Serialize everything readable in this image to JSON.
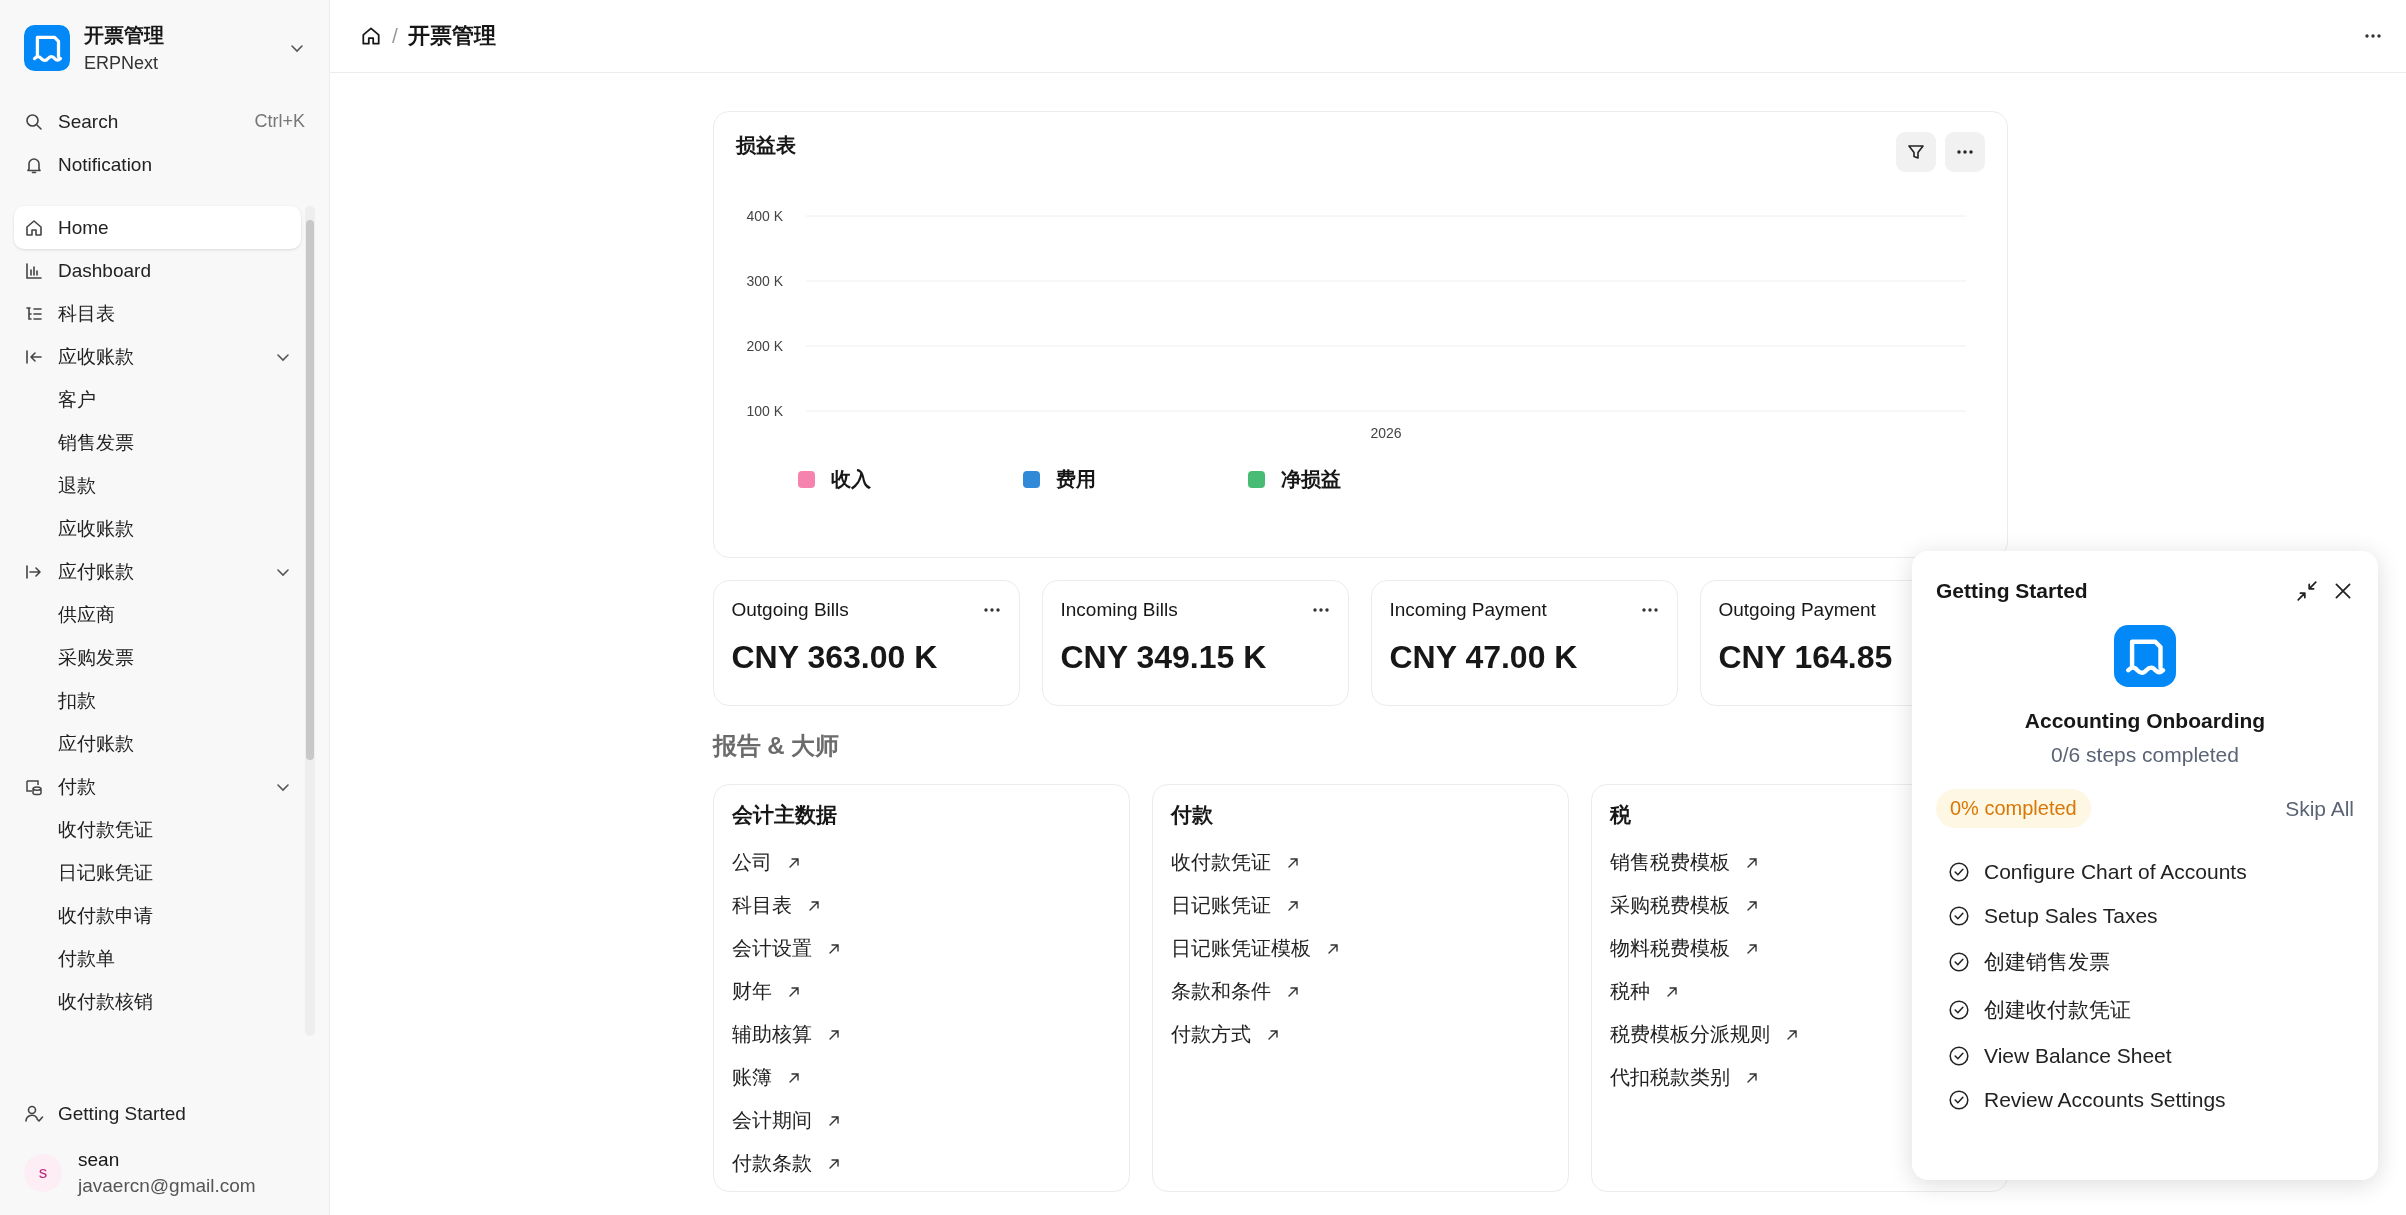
{
  "workspace": {
    "title": "开票管理",
    "subtitle": "ERPNext"
  },
  "quick": [
    {
      "label": "Search",
      "shortcut": "Ctrl+K"
    },
    {
      "label": "Notification"
    }
  ],
  "sidebar": {
    "items": [
      {
        "label": "Home",
        "selected": true
      },
      {
        "label": "Dashboard",
        "selected": false
      },
      {
        "label": "科目表",
        "selected": false
      },
      {
        "label": "应收账款",
        "selected": false,
        "expanded": true,
        "children": [
          {
            "label": "客户",
            "selected": false
          },
          {
            "label": "销售发票",
            "selected": false
          },
          {
            "label": "退款",
            "selected": false
          },
          {
            "label": "应收账款",
            "selected": false
          }
        ]
      },
      {
        "label": "应付账款",
        "selected": false,
        "expanded": true,
        "children": [
          {
            "label": "供应商",
            "selected": false
          },
          {
            "label": "采购发票",
            "selected": false
          },
          {
            "label": "扣款",
            "selected": false
          },
          {
            "label": "应付账款",
            "selected": false
          }
        ]
      },
      {
        "label": "付款",
        "selected": false,
        "expanded": true,
        "children": [
          {
            "label": "收付款凭证",
            "selected": false
          },
          {
            "label": "日记账凭证",
            "selected": false
          },
          {
            "label": "收付款申请",
            "selected": false
          },
          {
            "label": "付款单",
            "selected": false
          },
          {
            "label": "收付款核销",
            "selected": false
          }
        ]
      }
    ],
    "footer": "Getting Started",
    "user": {
      "initial": "s",
      "name": "sean",
      "email": "javaercn@gmail.com"
    }
  },
  "breadcrumb": {
    "separator": "/",
    "page": "开票管理"
  },
  "chart_card": {
    "title": "损益表",
    "chart_data": {
      "type": "line",
      "categories": [
        "2026"
      ],
      "ylim": [
        100000,
        400000
      ],
      "yticks": [
        {
          "value": 100000,
          "label": "100 K"
        },
        {
          "value": 200000,
          "label": "200 K"
        },
        {
          "value": 300000,
          "label": "300 K"
        },
        {
          "value": 400000,
          "label": "400 K"
        }
      ],
      "series": [
        {
          "name": "收入",
          "color": "#f683ae",
          "values": [
            null
          ]
        },
        {
          "name": "费用",
          "color": "#318ad8",
          "values": [
            null
          ]
        },
        {
          "name": "净损益",
          "color": "#48bb74",
          "values": [
            null
          ]
        }
      ]
    }
  },
  "number_cards": [
    {
      "label": "Outgoing Bills",
      "value": "CNY 363.00 K",
      "menu": true
    },
    {
      "label": "Incoming Bills",
      "value": "CNY 349.15 K",
      "menu": true
    },
    {
      "label": "Incoming Payment",
      "value": "CNY 47.00 K",
      "menu": true
    },
    {
      "label": "Outgoing Payment",
      "value": "CNY 164.85"
    }
  ],
  "section_title": "报告 & 大师",
  "shortcut_cards": [
    {
      "title": "会计主数据",
      "links": [
        "公司",
        "科目表",
        "会计设置",
        "财年",
        "辅助核算",
        "账簿",
        "会计期间",
        "付款条款"
      ]
    },
    {
      "title": "付款",
      "links": [
        "收付款凭证",
        "日记账凭证",
        "日记账凭证模板",
        "条款和条件",
        "付款方式"
      ]
    },
    {
      "title": "税",
      "links": [
        "销售税费模板",
        "采购税费模板",
        "物料税费模板",
        "税种",
        "税费模板分派规则",
        "代扣税款类别"
      ]
    }
  ],
  "onboarding": {
    "title": "Getting Started",
    "name": "Accounting Onboarding",
    "progress_text": "0/6 steps completed",
    "badge": "0% completed",
    "skip": "Skip All",
    "steps": [
      "Configure Chart of Accounts",
      "Setup Sales Taxes",
      "创建销售发票",
      "创建收付款凭证",
      "View Balance Sheet",
      "Review Accounts Settings"
    ]
  }
}
